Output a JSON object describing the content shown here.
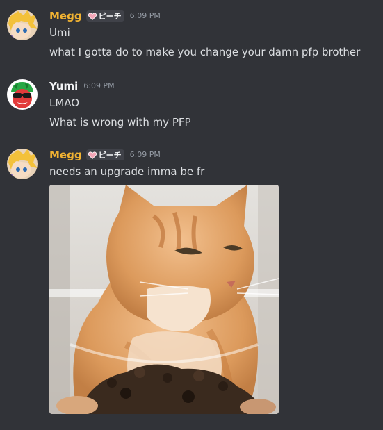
{
  "messages": [
    {
      "username": "Megg",
      "username_color": "#f0b232",
      "tag": "ピーチ",
      "timestamp": "6:09 PM",
      "lines": [
        "Umi",
        "what I gotta do to make you change your damn pfp brother"
      ]
    },
    {
      "username": "Yumi",
      "username_color": "#f2f3f5",
      "timestamp": "6:09 PM",
      "lines": [
        "LMAO",
        "What is wrong with my PFP"
      ]
    },
    {
      "username": "Megg",
      "username_color": "#f0b232",
      "tag": "ピーチ",
      "timestamp": "6:09 PM",
      "lines": [
        "needs an upgrade imma be fr"
      ],
      "attachment": "orange cat gif"
    }
  ],
  "icons": {
    "tag_icon": "heart-icon",
    "avatar_megg": "anime-avatar-icon",
    "avatar_yumi": "sunglasses-avatar-icon"
  }
}
